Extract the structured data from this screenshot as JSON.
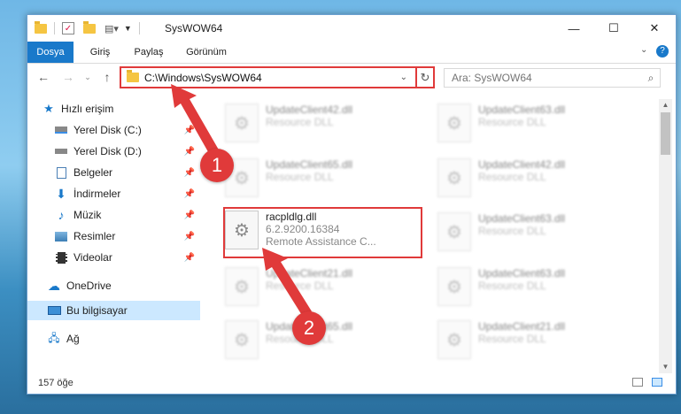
{
  "window": {
    "title": "SysWOW64",
    "controls": {
      "minimize": "—",
      "maximize": "☐",
      "close": "✕",
      "help": "?"
    }
  },
  "ribbon": {
    "tabs": [
      "Dosya",
      "Giriş",
      "Paylaş",
      "Görünüm"
    ]
  },
  "address": {
    "path": "C:\\Windows\\SysWOW64",
    "search_placeholder": "Ara: SysWOW64"
  },
  "nav": {
    "quick_access": "Hızlı erişim",
    "items": [
      {
        "label": "Yerel Disk (C:)",
        "icon": "drive-icon",
        "pinned": true
      },
      {
        "label": "Yerel Disk (D:)",
        "icon": "drive-icon",
        "pinned": true
      },
      {
        "label": "Belgeler",
        "icon": "documents-icon",
        "pinned": true
      },
      {
        "label": "İndirmeler",
        "icon": "download-icon",
        "pinned": true
      },
      {
        "label": "Müzik",
        "icon": "music-icon",
        "pinned": true
      },
      {
        "label": "Resimler",
        "icon": "pictures-icon",
        "pinned": true
      },
      {
        "label": "Videolar",
        "icon": "video-icon",
        "pinned": true
      }
    ],
    "onedrive": "OneDrive",
    "this_pc": "Bu bilgisayar",
    "network": "Ağ"
  },
  "files": {
    "left": [
      {
        "name": "UpdateClient42.dll",
        "sub": "Resource DLL"
      },
      {
        "name": "UpdateClient65.dll",
        "sub": "Resource DLL"
      },
      {
        "name": "UpdateClient21.dll",
        "sub": "Resource DLL"
      },
      {
        "name": "UpdateClient65.dll",
        "sub": "Resource DLL"
      }
    ],
    "right": [
      {
        "name": "UpdateClient63.dll",
        "sub": "Resource DLL"
      },
      {
        "name": "UpdateClient42.dll",
        "sub": "Resource DLL"
      },
      {
        "name": "UpdateClient63.dll",
        "sub": "Resource DLL"
      },
      {
        "name": "UpdateClient63.dll",
        "sub": "Resource DLL"
      },
      {
        "name": "UpdateClient21.dll",
        "sub": "Resource DLL"
      }
    ],
    "highlighted": {
      "name": "racpldlg.dll",
      "version": "6.2.9200.16384",
      "description": "Remote Assistance C..."
    }
  },
  "status": {
    "count": "157 öğe"
  },
  "annotations": {
    "step1": "1",
    "step2": "2",
    "color": "#e03a3a"
  }
}
